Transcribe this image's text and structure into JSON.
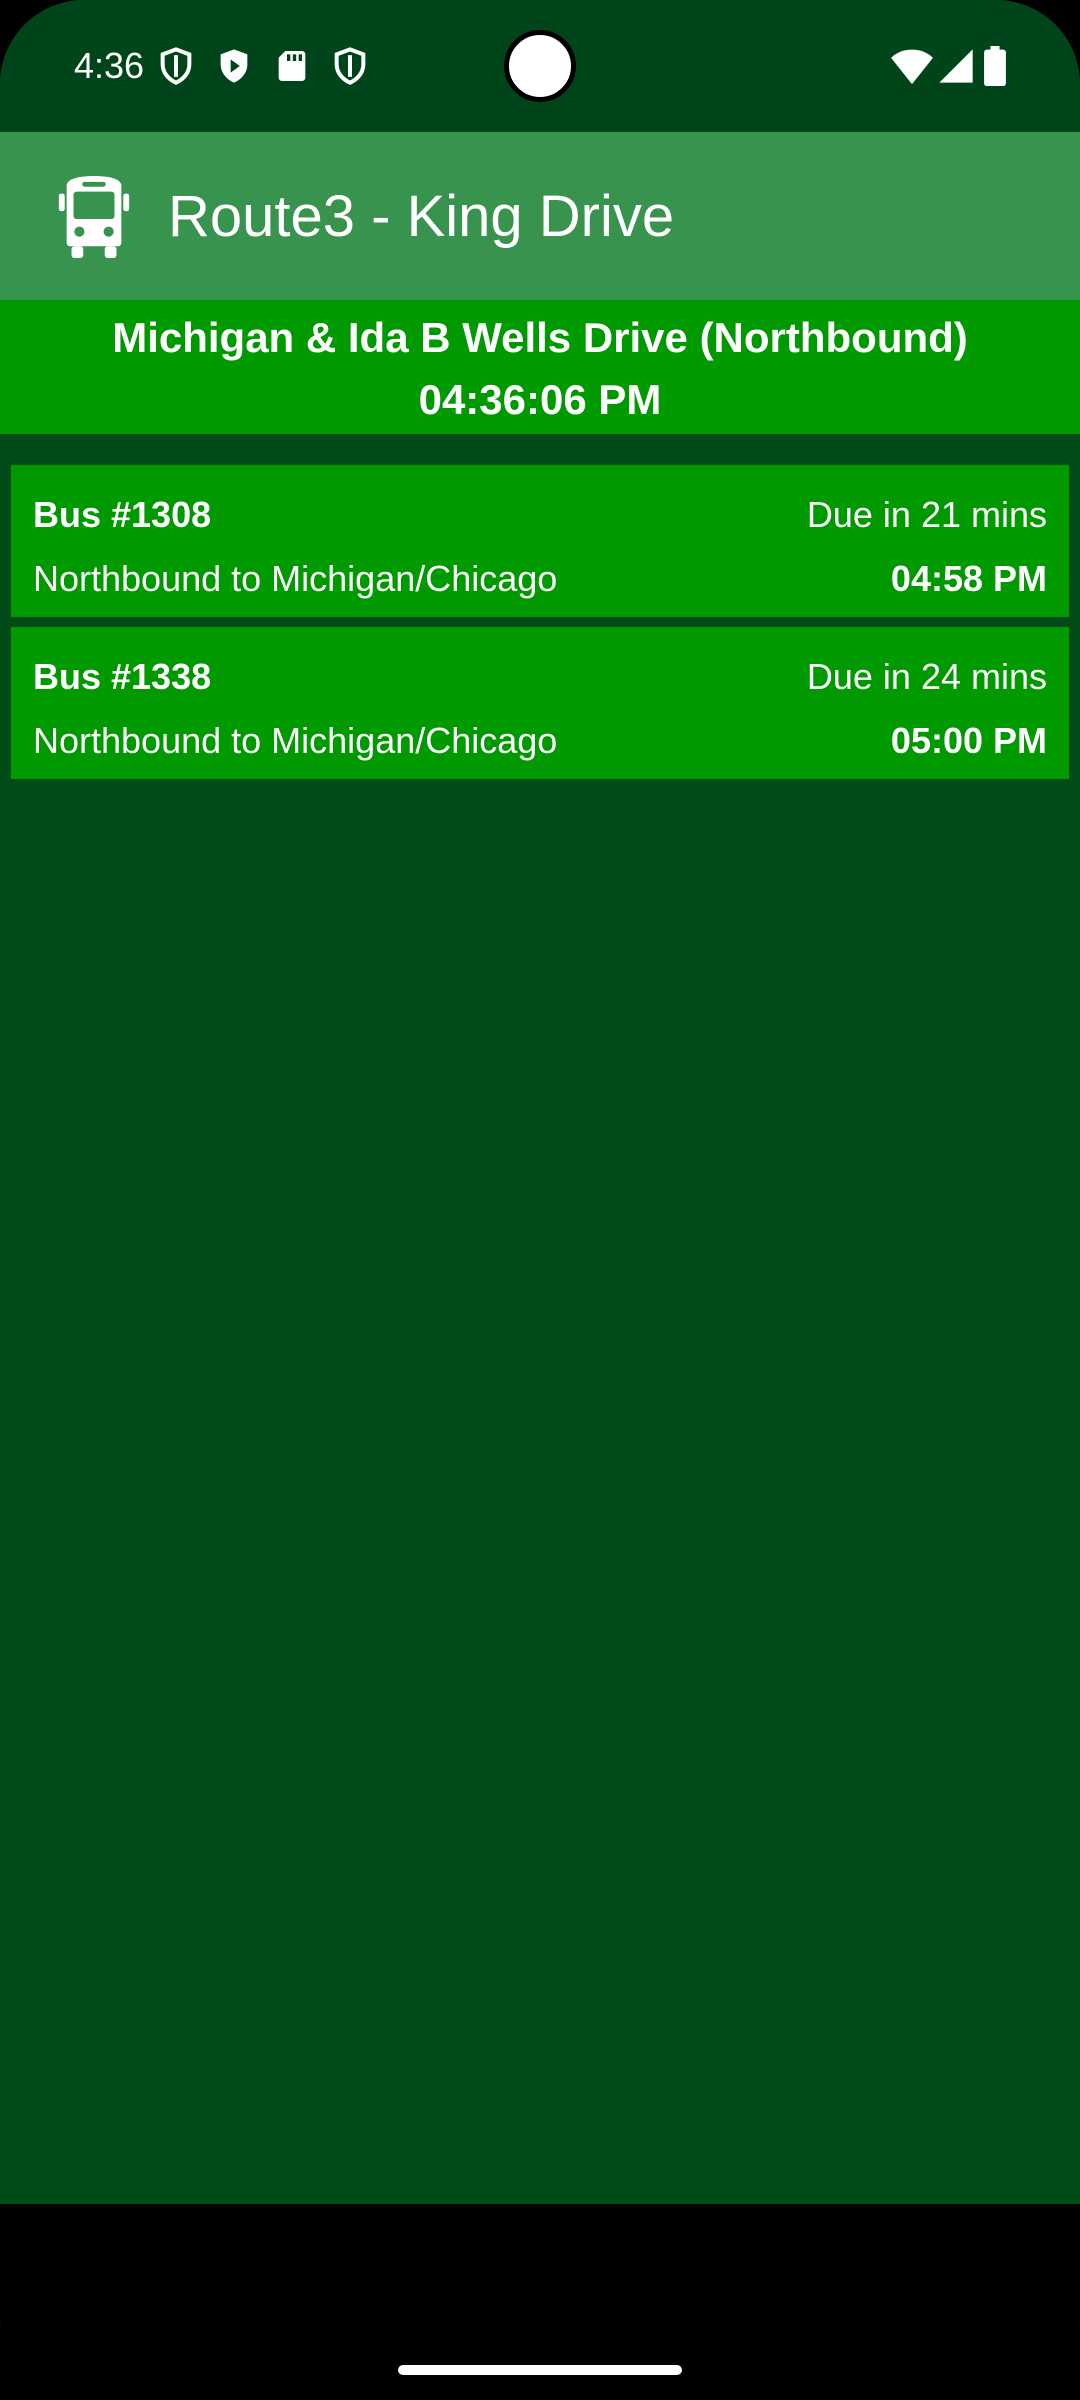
{
  "status_bar": {
    "time": "4:36",
    "left_icons": [
      "shield-outline-icon",
      "play-shield-icon",
      "sd-card-icon",
      "shield-outline-icon"
    ],
    "right_icons": [
      "wifi-icon",
      "cell-signal-icon",
      "battery-icon"
    ]
  },
  "app_bar": {
    "icon": "bus-icon",
    "title": "Route3 - King Drive"
  },
  "stop": {
    "name": "Michigan & Ida B Wells Drive (Northbound)",
    "current_time": "04:36:06 PM"
  },
  "arrivals": [
    {
      "bus": "Bus #1308",
      "due": "Due in 21 mins",
      "destination": "Northbound to Michigan/Chicago",
      "time": "04:58 PM"
    },
    {
      "bus": "Bus #1338",
      "due": "Due in 24 mins",
      "destination": "Northbound to Michigan/Chicago",
      "time": "05:00 PM"
    }
  ],
  "colors": {
    "background": "#004b18",
    "status_bar": "#00451a",
    "app_bar": "#38934f",
    "accent": "#009900",
    "text": "#ffffff"
  }
}
